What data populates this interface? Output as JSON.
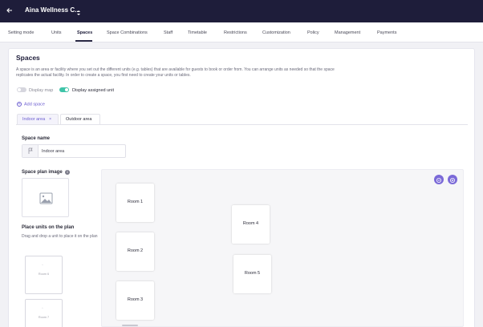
{
  "header": {
    "title": "Aina Wellness C...",
    "back_icon": "arrow-left-icon",
    "caret_icon": "caret-updown-icon",
    "background": "#1e1d3a"
  },
  "nav": {
    "tabs": [
      {
        "label": "Setting mode"
      },
      {
        "label": "Units"
      },
      {
        "label": "Spaces",
        "active": true
      },
      {
        "label": "Space Combinations"
      },
      {
        "label": "Staff"
      },
      {
        "label": "Timetable"
      },
      {
        "label": "Restrictions"
      },
      {
        "label": "Customization"
      },
      {
        "label": "Policy"
      },
      {
        "label": "Management"
      },
      {
        "label": "Payments"
      }
    ]
  },
  "main": {
    "title": "Spaces",
    "description": "A space is an area or facility where you set out the different units (e.g. tables) that are available for guests to book or order from. You can arrange units as needed so that the space replicates the actual facility. In order to create a space, you first need to create your units or tables.",
    "toggles": {
      "display_map": {
        "label": "Display map",
        "on": false
      },
      "display_assigned": {
        "label": "Display assigned unit",
        "on": true
      }
    },
    "add_space_label": "Add space",
    "area_tabs": [
      {
        "label": "Indoor area",
        "active": true,
        "close_icon": "close-icon"
      },
      {
        "label": "Outdoor area",
        "active": false
      }
    ],
    "space_name": {
      "label": "Space name",
      "value": "Indoor area",
      "icon": "flag-icon"
    },
    "space_plan_image": {
      "label": "Space plan image",
      "info_icon": "info-icon",
      "placeholder_icon": "image-icon"
    },
    "place_units": {
      "label": "Place units on the plan",
      "help": "Drag and drop a unit to place it on the plan",
      "units": [
        {
          "name": "Room 6"
        },
        {
          "name": "Room 7"
        }
      ]
    },
    "plan": {
      "rooms": [
        {
          "name": "Room 1"
        },
        {
          "name": "Room 2"
        },
        {
          "name": "Room 3"
        },
        {
          "name": "Room 4"
        },
        {
          "name": "Room 5"
        }
      ],
      "buttons": [
        {
          "icon": "zoom-out-icon"
        },
        {
          "icon": "zoom-in-icon"
        }
      ]
    }
  },
  "colors": {
    "accent": "#6b5dd0",
    "toggle_on": "#3fc4a8",
    "toggle_off": "#d6d6de",
    "plan_button": "#7b6ad8"
  }
}
